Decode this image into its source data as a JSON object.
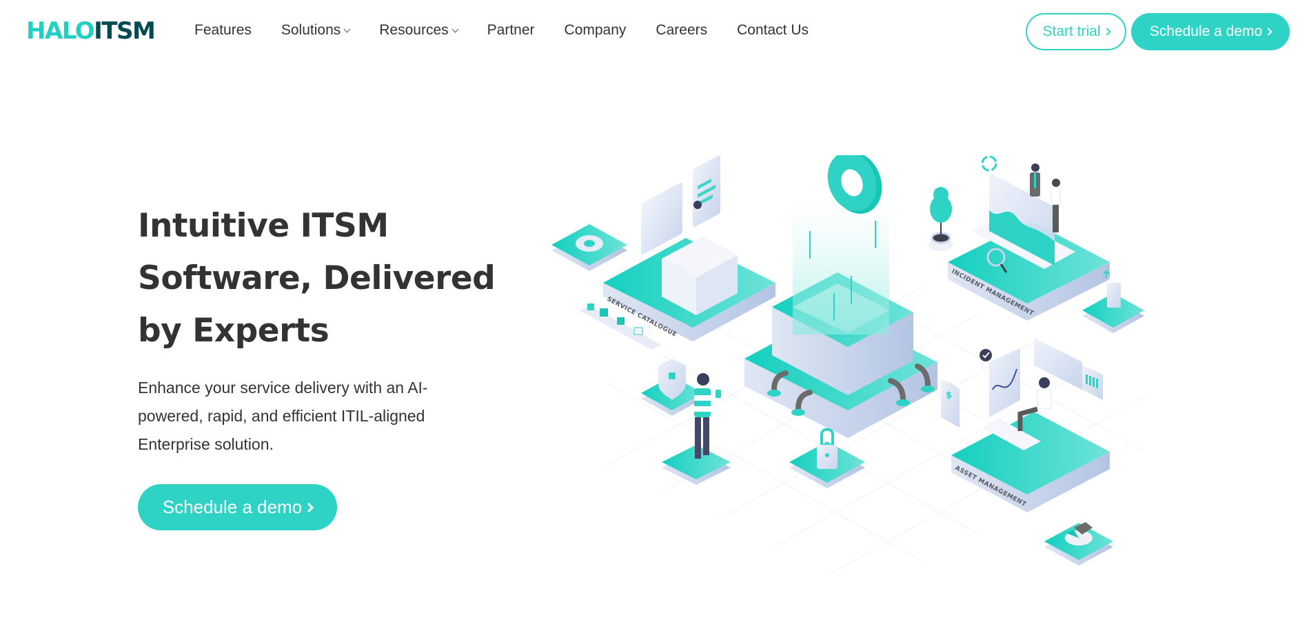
{
  "brand": {
    "logo_part1": "HALO",
    "logo_part2": "ITSM",
    "accent_color": "#2fd3c5",
    "logo_dark_color": "#004b52"
  },
  "nav": {
    "items": [
      {
        "label": "Features",
        "has_dropdown": false
      },
      {
        "label": "Solutions",
        "has_dropdown": true
      },
      {
        "label": "Resources",
        "has_dropdown": true
      },
      {
        "label": "Partner",
        "has_dropdown": false
      },
      {
        "label": "Company",
        "has_dropdown": false
      },
      {
        "label": "Careers",
        "has_dropdown": false
      },
      {
        "label": "Contact Us",
        "has_dropdown": false
      }
    ],
    "start_trial_label": "Start trial",
    "schedule_demo_label": "Schedule a demo"
  },
  "hero": {
    "title_lines": [
      "Intuitive ITSM",
      "Software, Delivered",
      "by Experts"
    ],
    "description_lines": [
      "Enhance your service delivery with an AI-",
      "powered, rapid, and efficient ITIL-aligned",
      "Enterprise solution."
    ],
    "cta_label": "Schedule a demo"
  },
  "illustration": {
    "platform_labels": {
      "service_catalogue": "SERVICE CATALOGUE",
      "incident_management": "INCIDENT MANAGEMENT",
      "asset_management": "ASSET MANAGEMENT"
    },
    "icons": [
      "gear-icon",
      "chat-bubble-icon",
      "shield-lock-icon",
      "padlock-icon",
      "magnifier-icon",
      "pie-chart-icon",
      "tree-icon",
      "refresh-icon",
      "checkmark-icon",
      "dollar-document-icon",
      "sync-arrows-icon"
    ]
  }
}
